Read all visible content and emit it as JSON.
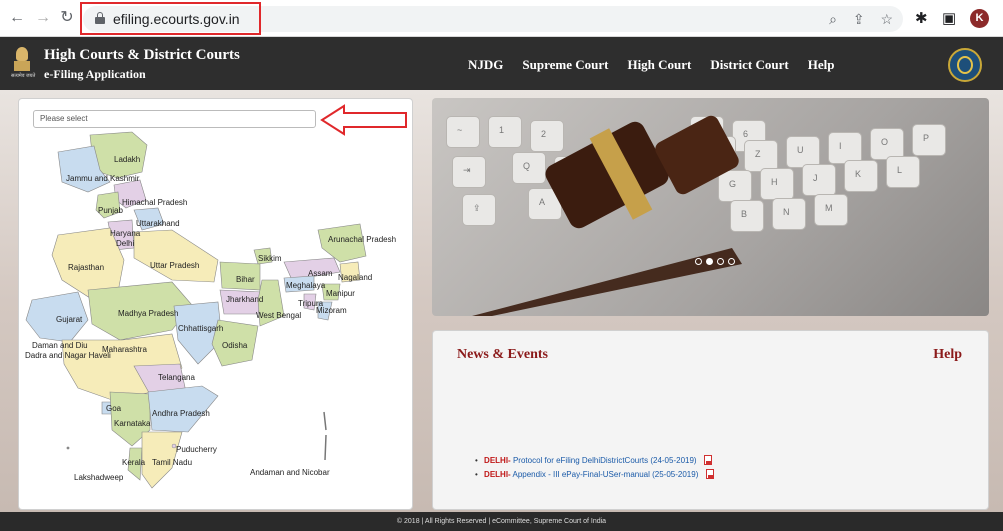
{
  "browser": {
    "url": "efiling.ecourts.gov.in",
    "avatar_letter": "K",
    "highlight_color": "#e0282b"
  },
  "header": {
    "title": "High Courts & District Courts",
    "subtitle": "e-Filing Application",
    "emblem_caption": "सत्यमेव जयते",
    "nav": [
      "NJDG",
      "Supreme Court",
      "High Court",
      "District Court",
      "Help"
    ]
  },
  "map": {
    "select_placeholder": "Please select",
    "states": [
      "Ladakh",
      "Jammu and Kashmir",
      "Himachal Pradesh",
      "Punjab",
      "Uttarakhand",
      "Haryana",
      "Delhi",
      "Rajasthan",
      "Uttar Pradesh",
      "Sikkim",
      "Arunachal Pradesh",
      "Assam",
      "Nagaland",
      "Meghalaya",
      "Manipur",
      "Bihar",
      "Jharkhand",
      "Tripura",
      "Mizoram",
      "West Bengal",
      "Gujarat",
      "Madhya Pradesh",
      "Chhattisgarh",
      "Daman and Diu",
      "Dadra and Nagar Haveli",
      "Maharashtra",
      "Odisha",
      "Telangana",
      "Goa",
      "Andhra Pradesh",
      "Karnataka",
      "Puducherry",
      "Kerala",
      "Tamil Nadu",
      "Lakshadweep",
      "Andaman and Nicobar"
    ]
  },
  "banner": {
    "slide_count": 4,
    "active_slide": 2
  },
  "news": {
    "title": "News & Events",
    "help": "Help",
    "items": [
      {
        "location": "DELHI-",
        "text": "Protocol for eFiling DelhiDistrictCourts  (24-05-2019)"
      },
      {
        "location": "DELHI-",
        "text": "Appendix - III ePay-Final-USer-manual  (25-05-2019)"
      }
    ]
  },
  "footer": {
    "text": "© 2018 | All Rights Reserved | eCommittee, Supreme Court of India"
  }
}
